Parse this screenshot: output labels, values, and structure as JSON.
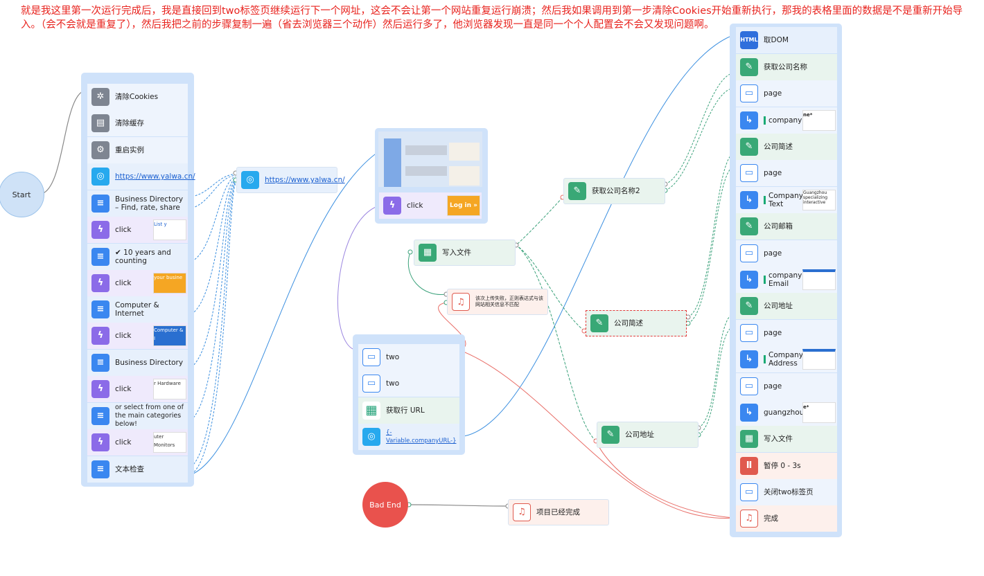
{
  "annotation": "就是我这里第一次运行完成后，我是直接回到two标签页继续运行下一个网址，这会不会让第一个网站重复运行崩溃；然后我如果调用到第一步清除Cookies开始重新执行，那我的表格里面的数据是不是重新开始导入。（会不会就是重复了），然后我把之前的步骤复制一遍（省去浏览器三个动作）然后运行多了，他浏览器发现一直是同一个个人配置会不会又发现问题啊。",
  "start": "Start",
  "bad_end": "Bad End",
  "left_nodes": [
    "清除Cookies",
    "清除缓存",
    "重启实例",
    "https://www.yalwa.cn/",
    "Business Directory – Find, rate, share",
    "click",
    "✔ 10 years and counting",
    "click",
    "Computer & Internet",
    "click",
    "Business Directory",
    "click",
    "or select from one of the main categories below!",
    "click",
    "文本检查"
  ],
  "left_thumbs": [
    "List y",
    "your busine",
    "Computer & I",
    "r Hardware",
    "uter Monitors"
  ],
  "yalwa_node": "https://www.yalwa.cn/",
  "login_click": "click",
  "login_thumb": "Log in »",
  "write_file_node": "写入文件",
  "alert_node": "该次上传失败，正则表达式与该网站相关信息不匹配",
  "company_name2": "获取公司名称2",
  "company_desc": "公司简述",
  "company_addr": "公司地址",
  "done_node": "项目已经完成",
  "mid_nodes": [
    "two",
    "two",
    "获取行 URL",
    "{-Variable.companyURL-}"
  ],
  "right_nodes": [
    {
      "label": "取DOM"
    },
    {
      "label": "获取公司名称"
    },
    {
      "label": "page"
    },
    {
      "label": "company",
      "thumb": "ne*"
    },
    {
      "label": "公司简述"
    },
    {
      "label": "page"
    },
    {
      "label": "CompanyText",
      "thumb": "Guangzhou specializing interactive"
    },
    {
      "label": "公司邮箱"
    },
    {
      "label": "page"
    },
    {
      "label": "companyEmail",
      "thumb": ""
    },
    {
      "label": "公司地址"
    },
    {
      "label": "page"
    },
    {
      "label": "CompanyAddress",
      "thumb": ""
    },
    {
      "label": "page"
    },
    {
      "label": "guangzhou",
      "thumb": "e*"
    },
    {
      "label": "写入文件"
    },
    {
      "label": "暂停 0 - 3s"
    },
    {
      "label": "关闭two标签页"
    },
    {
      "label": "完成"
    }
  ],
  "right_icons": [
    "HTML"
  ],
  "colors": {
    "blue_wire": "#3b8fe0",
    "green_wire": "#3aa17a",
    "red_wire": "#e86c66",
    "purple_wire": "#9b86e0",
    "annot_arrow": "#e8231e"
  }
}
